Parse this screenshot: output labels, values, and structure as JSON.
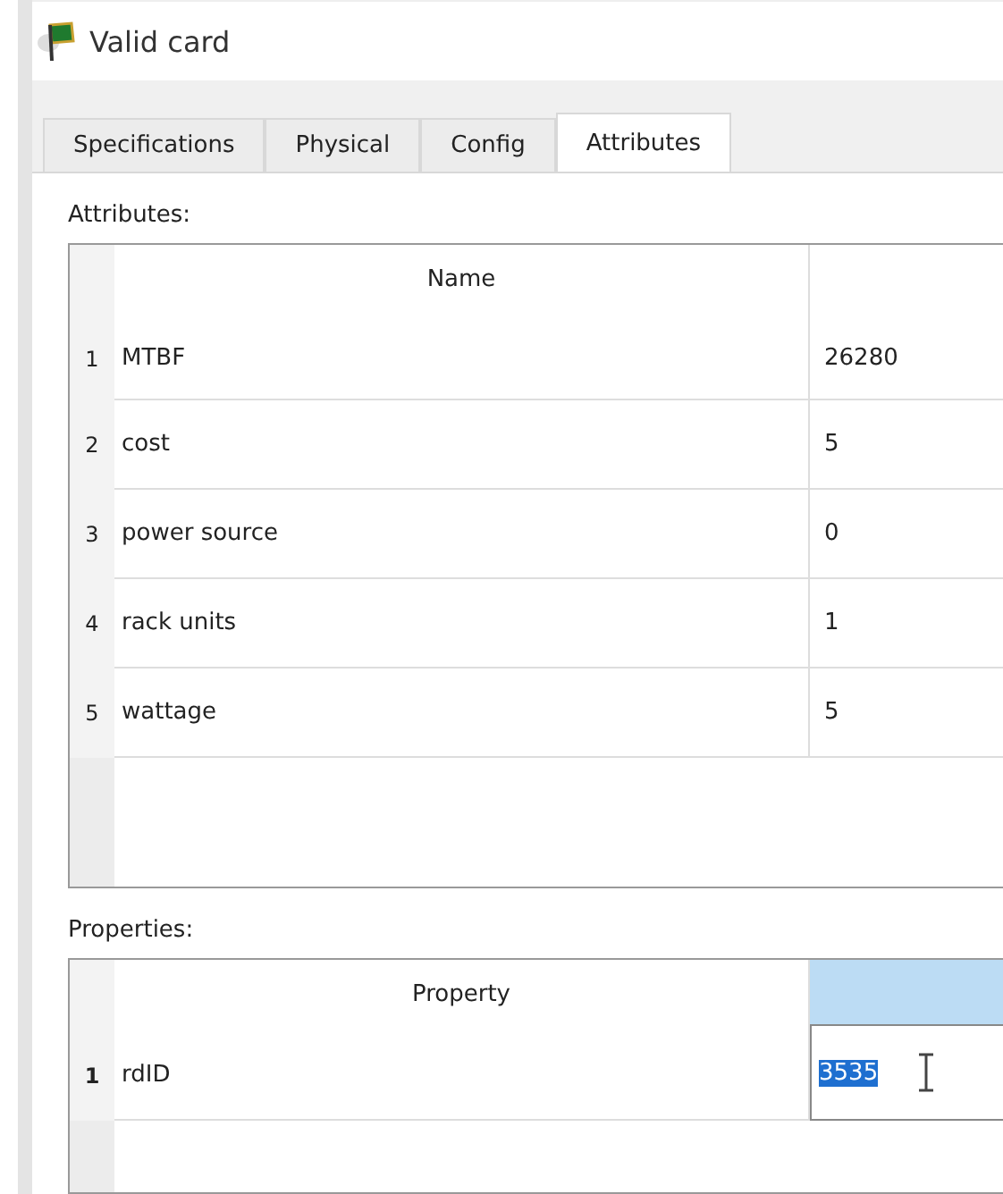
{
  "window": {
    "title": "Valid card"
  },
  "tabs": [
    {
      "label": "Specifications",
      "selected": false
    },
    {
      "label": "Physical",
      "selected": false
    },
    {
      "label": "Config",
      "selected": false
    },
    {
      "label": "Attributes",
      "selected": true
    }
  ],
  "attributes": {
    "label": "Attributes:",
    "columns": [
      "Name"
    ],
    "rows": [
      {
        "index": "1",
        "name": "MTBF",
        "value": "26280"
      },
      {
        "index": "2",
        "name": "cost",
        "value": "5"
      },
      {
        "index": "3",
        "name": "power source",
        "value": "0"
      },
      {
        "index": "4",
        "name": "rack units",
        "value": "1"
      },
      {
        "index": "5",
        "name": "wattage",
        "value": "5"
      }
    ]
  },
  "properties": {
    "label": "Properties:",
    "columns": [
      "Property"
    ],
    "rows": [
      {
        "index": "1",
        "name": "rdID",
        "value": "3535",
        "editing": true
      }
    ]
  }
}
